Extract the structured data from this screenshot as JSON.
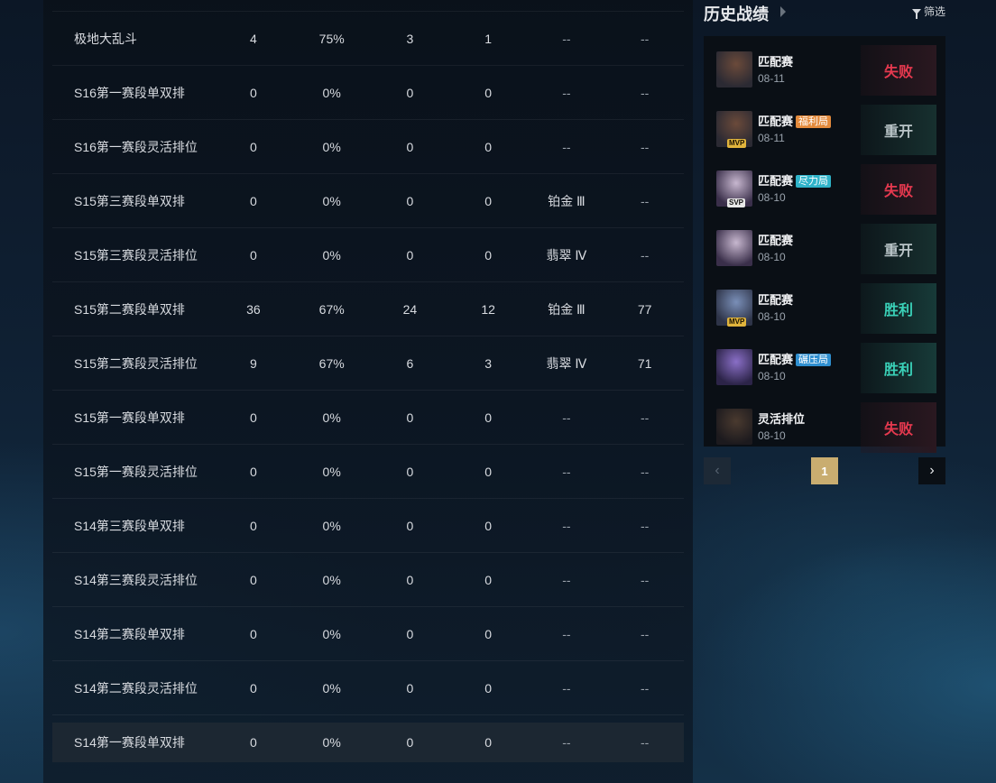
{
  "stats": {
    "rows": [
      {
        "name": "极地大乱斗",
        "games": "4",
        "winrate": "75%",
        "wins": "3",
        "losses": "1",
        "rank": "--",
        "lp": "--"
      },
      {
        "name": "S16第一赛段单双排",
        "games": "0",
        "winrate": "0%",
        "wins": "0",
        "losses": "0",
        "rank": "--",
        "lp": "--"
      },
      {
        "name": "S16第一赛段灵活排位",
        "games": "0",
        "winrate": "0%",
        "wins": "0",
        "losses": "0",
        "rank": "--",
        "lp": "--"
      },
      {
        "name": "S15第三赛段单双排",
        "games": "0",
        "winrate": "0%",
        "wins": "0",
        "losses": "0",
        "rank": "铂金 Ⅲ",
        "lp": "--"
      },
      {
        "name": "S15第三赛段灵活排位",
        "games": "0",
        "winrate": "0%",
        "wins": "0",
        "losses": "0",
        "rank": "翡翠 Ⅳ",
        "lp": "--"
      },
      {
        "name": "S15第二赛段单双排",
        "games": "36",
        "winrate": "67%",
        "wins": "24",
        "losses": "12",
        "rank": "铂金 Ⅲ",
        "lp": "77"
      },
      {
        "name": "S15第二赛段灵活排位",
        "games": "9",
        "winrate": "67%",
        "wins": "6",
        "losses": "3",
        "rank": "翡翠 Ⅳ",
        "lp": "71"
      },
      {
        "name": "S15第一赛段单双排",
        "games": "0",
        "winrate": "0%",
        "wins": "0",
        "losses": "0",
        "rank": "--",
        "lp": "--"
      },
      {
        "name": "S15第一赛段灵活排位",
        "games": "0",
        "winrate": "0%",
        "wins": "0",
        "losses": "0",
        "rank": "--",
        "lp": "--"
      },
      {
        "name": "S14第三赛段单双排",
        "games": "0",
        "winrate": "0%",
        "wins": "0",
        "losses": "0",
        "rank": "--",
        "lp": "--"
      },
      {
        "name": "S14第三赛段灵活排位",
        "games": "0",
        "winrate": "0%",
        "wins": "0",
        "losses": "0",
        "rank": "--",
        "lp": "--"
      },
      {
        "name": "S14第二赛段单双排",
        "games": "0",
        "winrate": "0%",
        "wins": "0",
        "losses": "0",
        "rank": "--",
        "lp": "--"
      },
      {
        "name": "S14第二赛段灵活排位",
        "games": "0",
        "winrate": "0%",
        "wins": "0",
        "losses": "0",
        "rank": "--",
        "lp": "--"
      },
      {
        "name": "S14第一赛段单双排",
        "games": "0",
        "winrate": "0%",
        "wins": "0",
        "losses": "0",
        "rank": "--",
        "lp": "--"
      }
    ]
  },
  "history": {
    "title": "历史战绩",
    "filter_label": "筛选",
    "matches": [
      {
        "mode": "匹配赛",
        "tag": "",
        "tag_color": "",
        "badge": "",
        "date": "08-11",
        "result": "失败",
        "result_type": "lose",
        "avatar_colors": [
          "#6b4a3a",
          "#2b2a33"
        ]
      },
      {
        "mode": "匹配赛",
        "tag": "福利局",
        "tag_color": "#e38a3c",
        "badge": "MVP",
        "date": "08-11",
        "result": "重开",
        "result_type": "remake",
        "avatar_colors": [
          "#6b4a3a",
          "#2b2a33"
        ]
      },
      {
        "mode": "匹配赛",
        "tag": "尽力局",
        "tag_color": "#2fb3c9",
        "badge": "SVP",
        "date": "08-10",
        "result": "失败",
        "result_type": "lose",
        "avatar_colors": [
          "#c7b7cf",
          "#3a2f4a"
        ]
      },
      {
        "mode": "匹配赛",
        "tag": "",
        "tag_color": "",
        "badge": "",
        "date": "08-10",
        "result": "重开",
        "result_type": "remake",
        "avatar_colors": [
          "#c7b7cf",
          "#3a2f4a"
        ]
      },
      {
        "mode": "匹配赛",
        "tag": "",
        "tag_color": "",
        "badge": "MVP",
        "date": "08-10",
        "result": "胜利",
        "result_type": "win",
        "avatar_colors": [
          "#7a8fb8",
          "#2e3448"
        ]
      },
      {
        "mode": "匹配赛",
        "tag": "碾压局",
        "tag_color": "#2f8fd0",
        "badge": "",
        "date": "08-10",
        "result": "胜利",
        "result_type": "win",
        "avatar_colors": [
          "#8a6fc7",
          "#2c2448"
        ]
      },
      {
        "mode": "灵活排位",
        "tag": "",
        "tag_color": "",
        "badge": "",
        "date": "08-10",
        "result": "失败",
        "result_type": "lose",
        "avatar_colors": [
          "#4a3a2f",
          "#1c1a1e"
        ]
      }
    ]
  },
  "pagination": {
    "current_page": "1",
    "prev_icon": "chevron-left-icon",
    "next_icon": "chevron-right-icon"
  }
}
